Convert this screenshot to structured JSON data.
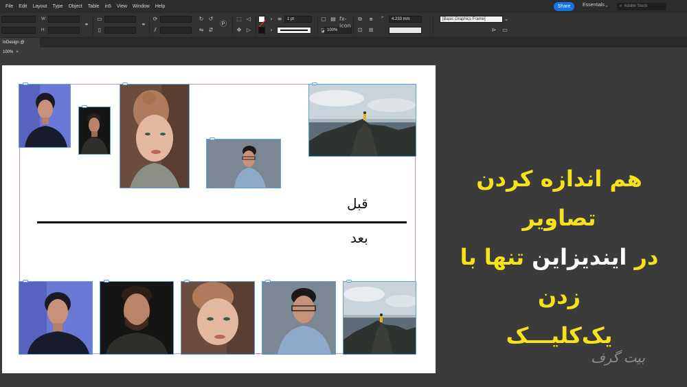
{
  "menu": [
    "File",
    "Edit",
    "Layout",
    "Type",
    "Object",
    "Table",
    "in5",
    "View",
    "Window",
    "Help"
  ],
  "toolbar": {
    "share_label": "Share",
    "workspace_label": "Essentials",
    "stock_search_placeholder": "Adobe Stock",
    "stroke_weight": "1 pt",
    "zoom_value": "100%",
    "dimension_value": "4.233 mm",
    "object_style": "[Basic Graphics Frame]",
    "label_w": "W:",
    "label_h": "H:",
    "icons": [
      "rotate-icon",
      "flip-icon",
      "stroke-swatch-icon",
      "fill-swatch-icon",
      "align-icon",
      "fx-icon"
    ]
  },
  "tab": {
    "title": "InDesign @ 100%",
    "close": "×"
  },
  "canvas": {
    "label_before": "قبل",
    "label_after": "بعد"
  },
  "images": {
    "before": [
      {
        "name": "woman-blue-portrait"
      },
      {
        "name": "man-dark-portrait"
      },
      {
        "name": "redhead-woman-portrait"
      },
      {
        "name": "man-glasses-portrait"
      },
      {
        "name": "mountain-landscape"
      }
    ],
    "after": [
      {
        "name": "woman-blue-portrait"
      },
      {
        "name": "man-dark-portrait"
      },
      {
        "name": "redhead-woman-portrait"
      },
      {
        "name": "man-glasses-portrait"
      },
      {
        "name": "mountain-landscape"
      }
    ]
  },
  "headline": {
    "line1": "هم اندازه کردن تصاویر",
    "line2_before": "در ",
    "line2_highlight": "ایندیزاین",
    "line2_after": " تنها با زدن",
    "line3": "یک‌کلیـــک"
  },
  "watermark": "بیت گرف",
  "colors": {
    "headline": "#f6e21a",
    "share": "#1473e6",
    "frame_guide": "#c98bd6",
    "selection": "#5aa0e6"
  }
}
